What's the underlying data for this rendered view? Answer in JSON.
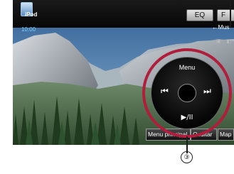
{
  "header": {
    "source_icon": "ipod-icon",
    "source_label": "iPod",
    "time": "10:00",
    "eq_label": "EQ",
    "f_label": "F",
    "music_label": "←Mus"
  },
  "controller": {
    "menu_label": "Menu",
    "prev_icon": "⏮",
    "next_icon": "⏭",
    "play_pause_label": "▶/II"
  },
  "bottom_bar": {
    "buttons": [
      "Menu principal",
      "Ocultar",
      "Map"
    ]
  },
  "callout": {
    "number": "③"
  },
  "colors": {
    "callout_ring": "#b01e3c",
    "time_text": "#7ad0ff"
  }
}
